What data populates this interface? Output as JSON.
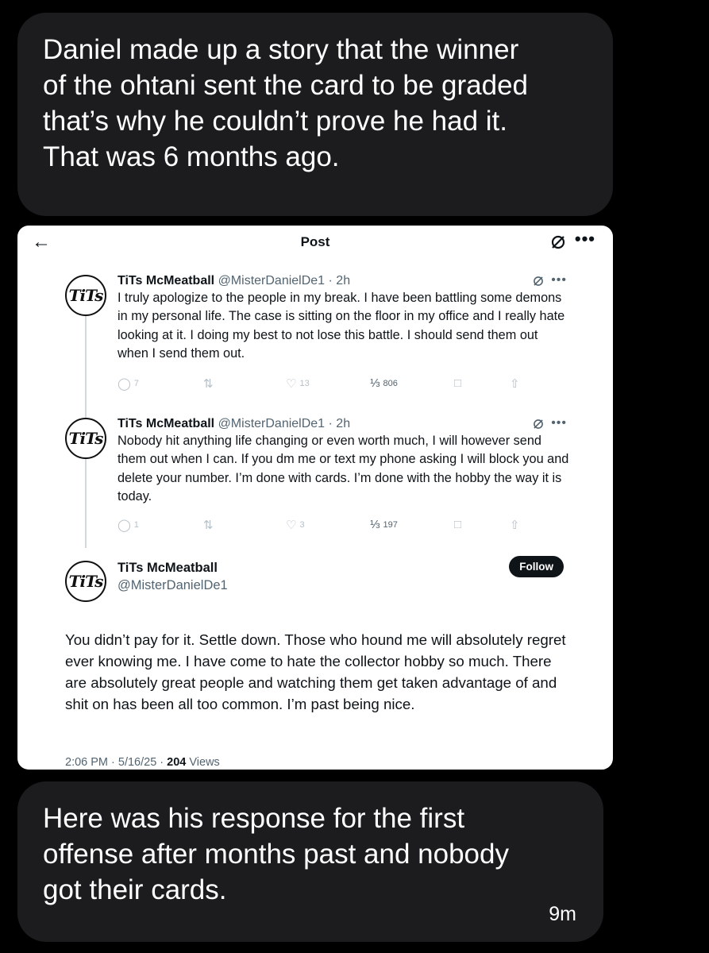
{
  "message_top": {
    "text": "Daniel made up a story that the winner\nof the ohtani sent the card to be graded\nthat’s why he couldn’t prove he had it.\nThat was 6 months ago."
  },
  "screenshot": {
    "topbar": {
      "back_icon": "arrow-left",
      "title": "Post",
      "grok_icon": "grok-slash-circle",
      "more": "•••"
    },
    "tweets": [
      {
        "avatar_text": "TiTs",
        "name": "TiTs McMeatball",
        "handle": "@MisterDanielDe1",
        "time": "· 2h",
        "more": "•••",
        "text": "I truly apologize to the people in my break. I have been battling some demons in my personal life. The case is sitting on the floor in my office and I really hate looking at it. I doing my best to not lose this battle. I should send them out when I send them out.",
        "replies": "7",
        "likes": "13",
        "views": "806"
      },
      {
        "avatar_text": "TiTs",
        "name": "TiTs McMeatball",
        "handle": "@MisterDanielDe1",
        "time": "· 2h",
        "more": "•••",
        "text": "Nobody hit anything life changing or even worth much, I will however send them out when I can. If you dm me or text my phone asking I will block you and delete your number. I’m done with cards. I’m done with the hobby the way it is today.",
        "replies": "1",
        "likes": "3",
        "views": "197"
      }
    ],
    "main_tweet": {
      "avatar_text": "TiTs",
      "name": "TiTs McMeatball",
      "handle": "@MisterDanielDe1",
      "follow_label": "Follow",
      "text": "You didn’t pay for it. Settle down. Those who hound me will absolutely regret ever knowing me. I have come to hate the collector hobby so much. There are absolutely great people and watching them get taken advantage of and shit on has been all too common. I’m past being nice.",
      "time": "2:06 PM · 5/16/25 · ",
      "views_count": "204",
      "views_label": " Views"
    }
  },
  "message_bottom": {
    "text": "Here was his response for the first\noffense after months past and nobody\ngot their cards.",
    "time": "9m"
  },
  "colors": {
    "background": "#000000",
    "bubble": "#1c1c1e",
    "follow_button": "#0f1419",
    "secondary_text": "#536471"
  }
}
